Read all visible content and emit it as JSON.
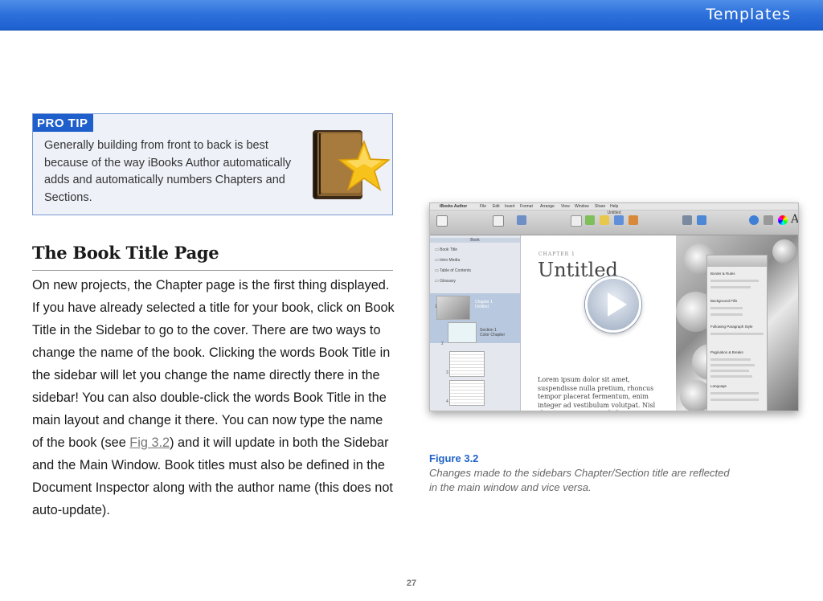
{
  "header": {
    "title": "Templates"
  },
  "protip": {
    "label": "PRO TIP",
    "text": "Generally building from front to back is best because of the way iBooks Author automatically adds and automatically numbers Chapters and Sections."
  },
  "section": {
    "title": "The Book Title Page",
    "body_before_link": "On new projects, the Chapter page is the first thing displayed. If you have already selected a title for your book, click on Book Title in the Sidebar to go to the cover. There are two ways to change the name of the book. Clicking the words Book Title in the sidebar will let you change the name directly there in the sidebar! You can also double-click the words Book Title in the main layout and change it there. You can now type the name of the book (see ",
    "link_text": "Fig 3.2",
    "body_after_link": ") and it will update in both the Sidebar and the Main Window. Book titles must also be defined in the Document Inspector along with the author name (this does not auto-update)."
  },
  "screenshot": {
    "menu": [
      "iBooks Author",
      "File",
      "Edit",
      "Insert",
      "Format",
      "Arrange",
      "View",
      "Window",
      "Share",
      "Help"
    ],
    "window_title": "Untitled",
    "sidebar_header": "Book",
    "sidebar_items": [
      "Book Title",
      "Intro Media",
      "Table of Contents",
      "Glossary"
    ],
    "chapter_item": "Chapter 1\nUntitled",
    "section_item": "Section 1\nColor Chapter",
    "page_numbers": [
      "1",
      "2",
      "3",
      "4"
    ],
    "chapter_label": "CHAPTER 1",
    "page_title": "Untitled",
    "lorem": "Lorem ipsum dolor sit amet, suspendisse nulla pretium, rhoncus tempor placerat fermentum, enim integer ad vestibulum volutpat. Nisl rhoncus turpis est, vel elit",
    "inspector_items": [
      "Border & Rules",
      "Background Fills",
      "Following Paragraph Style",
      "Pagination & Breaks",
      "Language"
    ]
  },
  "figure": {
    "number": "Figure 3.2",
    "caption": "Changes made to the sidebars Chapter/Section title are reflected in the main window and vice versa."
  },
  "footer": {
    "page_number": "27"
  }
}
